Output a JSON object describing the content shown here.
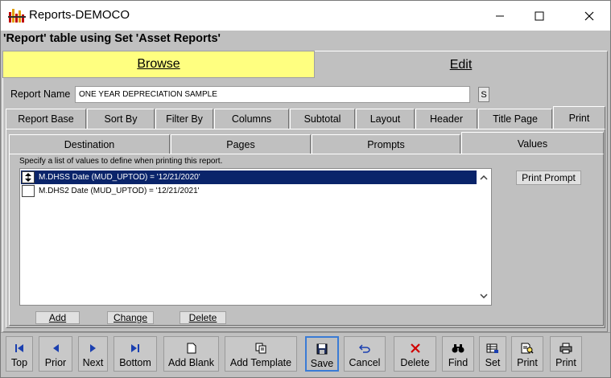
{
  "window": {
    "title": "Reports-DEMOCO"
  },
  "caption": "'Report' table using Set 'Asset Reports'",
  "mode_tabs": {
    "browse": "Browse",
    "edit": "Edit"
  },
  "report_name": {
    "label": "Report Name",
    "value": "ONE YEAR DEPRECIATION SAMPLE",
    "s_button": "S"
  },
  "main_tabs": [
    "Report Base",
    "Sort By",
    "Filter By",
    "Columns",
    "Subtotal",
    "Layout",
    "Header",
    "Title Page",
    "Print"
  ],
  "active_main_tab": "Print",
  "sub_tabs": [
    "Destination",
    "Pages",
    "Prompts",
    "Values"
  ],
  "active_sub_tab": "Values",
  "values_panel": {
    "hint": "Specify a list of values to define when printing this report.",
    "rows": [
      {
        "text": "M.DHSS Date (MUD_UPTOD) = '12/21/2020'",
        "selected": true
      },
      {
        "text": "M.DHS2 Date (MUD_UPTOD) = '12/21/2021'",
        "selected": false
      }
    ],
    "print_prompt": "Print Prompt",
    "add": "Add",
    "change": "Change",
    "delete": "Delete"
  },
  "toolbar": {
    "top": "Top",
    "prior": "Prior",
    "next": "Next",
    "bottom": "Bottom",
    "add_blank": "Add Blank",
    "add_template": "Add Template",
    "save": "Save",
    "cancel": "Cancel",
    "delete": "Delete",
    "find": "Find",
    "set": "Set",
    "print1": "Print",
    "print2": "Print"
  },
  "colors": {
    "browse_tab": "#ffff80",
    "selection": "#0a246a",
    "background": "#c0c0c0",
    "save_focus": "#3a7bd5",
    "delete_icon": "#d00000"
  }
}
